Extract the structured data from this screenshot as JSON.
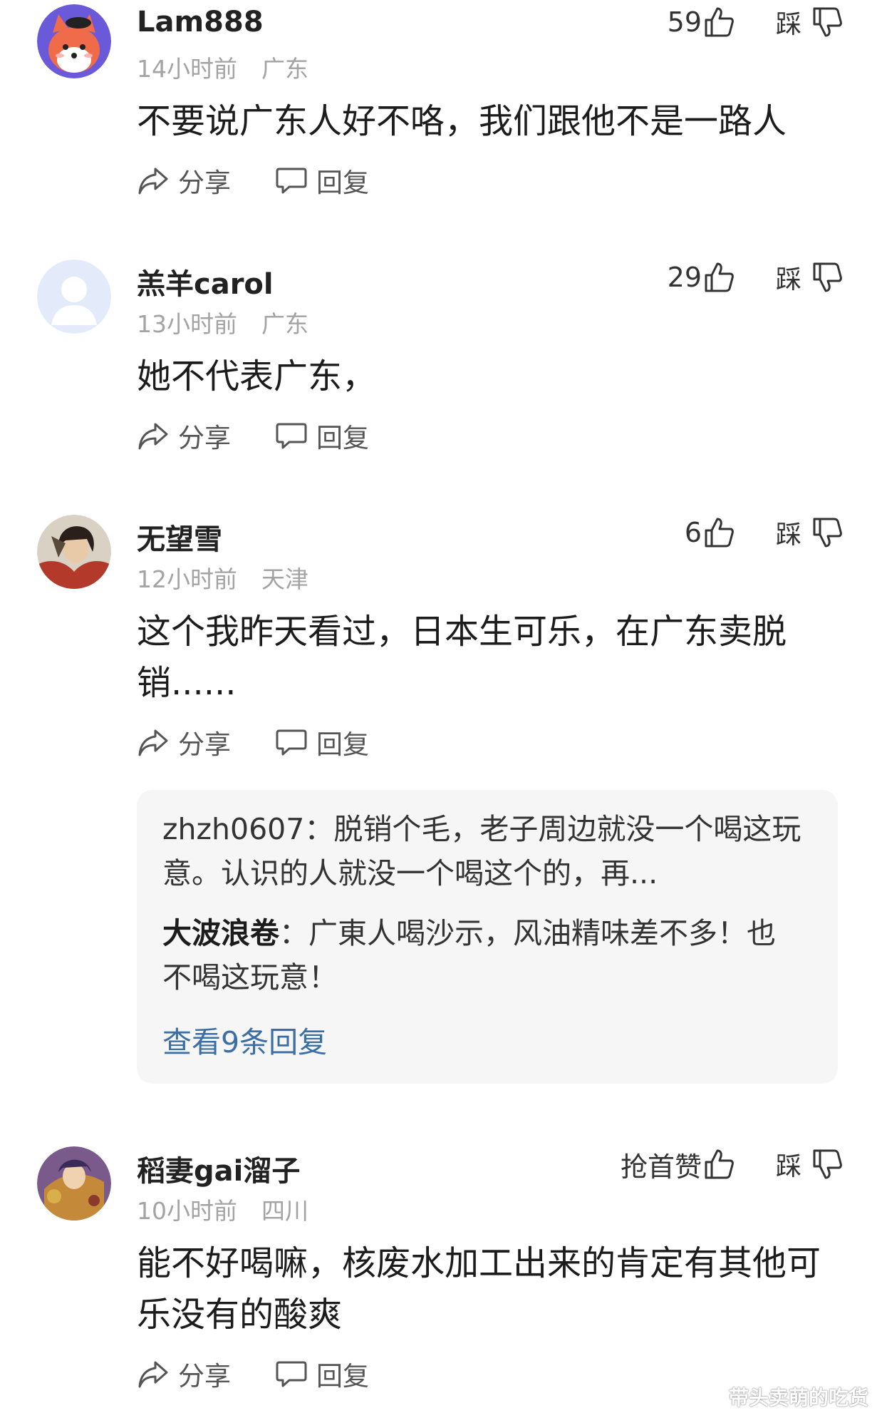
{
  "comments": [
    {
      "username": "Lam888",
      "time": "14小时前",
      "location": "广东",
      "likes": "59",
      "dislike_label": "踩",
      "text": "不要说广东人好不咯，我们跟他不是一路人",
      "share_label": "分享",
      "reply_label": "回复"
    },
    {
      "username": "羔羊carol",
      "time": "13小时前",
      "location": "广东",
      "likes": "29",
      "dislike_label": "踩",
      "text": "她不代表广东，",
      "share_label": "分享",
      "reply_label": "回复"
    },
    {
      "username": "无望雪",
      "time": "12小时前",
      "location": "天津",
      "likes": "6",
      "dislike_label": "踩",
      "text": "这个我昨天看过，日本生可乐，在广东卖脱销......",
      "share_label": "分享",
      "reply_label": "回复",
      "replies": [
        {
          "name": "zhzh0607",
          "text": "脱销个毛，老子周边就没一个喝这玩意。认识的人就没一个喝这个的，再..."
        },
        {
          "name": "大波浪卷",
          "text": "广東人喝沙示，风油精味差不多！也不喝这玩意！"
        }
      ],
      "view_more": "查看9条回复"
    },
    {
      "username": "稻妻gai溜子",
      "time": "10小时前",
      "location": "四川",
      "likes": "抢首赞",
      "dislike_label": "踩",
      "text": "能不好喝嘛，核废水加工出来的肯定有其他可乐没有的酸爽",
      "share_label": "分享",
      "reply_label": "回复"
    }
  ],
  "watermark": "带头卖萌的吃货",
  "separator": "："
}
